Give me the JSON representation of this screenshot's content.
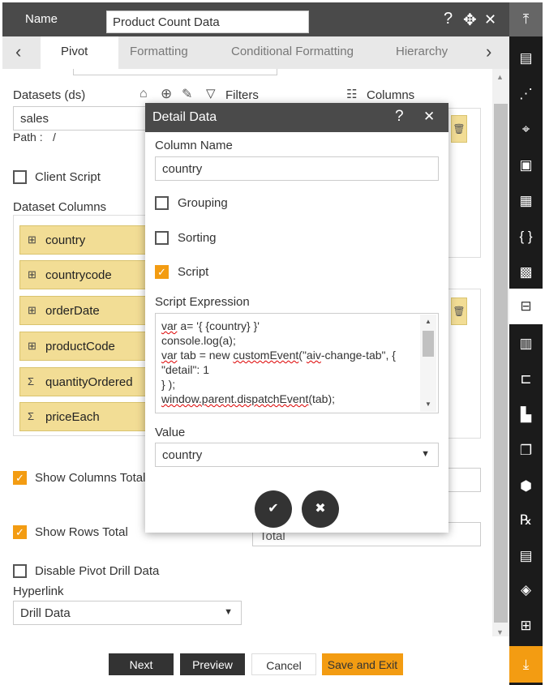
{
  "header": {
    "name_label": "Name",
    "name_value": "Product Count Data",
    "help_icon": "?",
    "move_icon": "✥",
    "close_icon": "✕"
  },
  "tabs": [
    {
      "label": "Pivot"
    },
    {
      "label": "Formatting"
    },
    {
      "label": "Conditional Formatting"
    },
    {
      "label": "Hierarchy"
    }
  ],
  "datasets": {
    "label": "Datasets (ds)",
    "filters_label": "Filters",
    "columns_label": "Columns",
    "value": "sales",
    "path_label": "Path :",
    "path_value": "/"
  },
  "client_script": {
    "label": "Client Script",
    "checked": false
  },
  "dataset_columns": {
    "label": "Dataset Columns",
    "items": [
      {
        "name": "country",
        "icon": "table-icon"
      },
      {
        "name": "countrycode",
        "icon": "table-icon"
      },
      {
        "name": "orderDate",
        "icon": "table-icon"
      },
      {
        "name": "productCode",
        "icon": "table-icon"
      },
      {
        "name": "quantityOrdered",
        "icon": "sigma-icon"
      },
      {
        "name": "priceEach",
        "icon": "sigma-icon"
      }
    ]
  },
  "show_columns_total": {
    "label": "Show Columns Total",
    "checked": true
  },
  "show_rows_total": {
    "label": "Show Rows Total",
    "checked": true,
    "value": "Total"
  },
  "disable_drill": {
    "label": "Disable Pivot Drill Data",
    "checked": false
  },
  "hyperlink": {
    "label": "Hyperlink",
    "value": "Drill Data"
  },
  "footer": {
    "next": "Next",
    "preview": "Preview",
    "cancel": "Cancel",
    "save_exit": "Save and Exit"
  },
  "modal": {
    "title": "Detail Data",
    "column_name_label": "Column Name",
    "column_name_value": "country",
    "grouping_label": "Grouping",
    "grouping_checked": false,
    "sorting_label": "Sorting",
    "sorting_checked": false,
    "script_label": "Script",
    "script_checked": true,
    "script_expression_label": "Script Expression",
    "script_lines": [
      "var a= '{ {country} }'",
      "console.log(a);",
      "var tab = new customEvent(\"aiv-change-tab\", {",
      "\"detail\": 1",
      "} );",
      "window.parent.dispatchEvent(tab);"
    ],
    "value_label": "Value",
    "value_value": "country"
  },
  "colors": {
    "accent": "#f39c12",
    "header_bg": "#4a4a4a",
    "column_item_bg": "#f2dd95",
    "rail_bg": "#1b1b1b"
  }
}
